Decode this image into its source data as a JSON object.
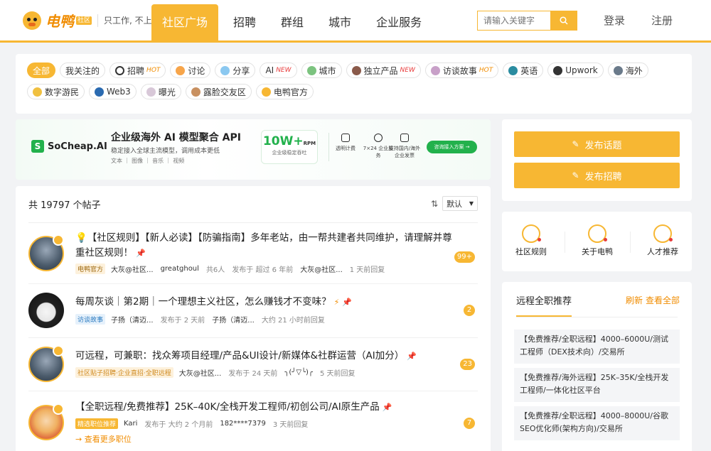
{
  "header": {
    "logo_text": "电鸭",
    "logo_badge": "社区",
    "slogan": "只工作, 不上班",
    "nav": [
      "社区广场",
      "招聘",
      "群组",
      "城市",
      "企业服务"
    ],
    "search_placeholder": "请输入关键字",
    "login": "登录",
    "register": "注册"
  },
  "tags": {
    "row1": [
      {
        "label": "全部",
        "active": true
      },
      {
        "label": "我关注的"
      },
      {
        "label": "招聘",
        "badge": "HOT"
      },
      {
        "label": "讨论"
      },
      {
        "label": "分享"
      },
      {
        "label": "AI",
        "badge": "NEW"
      },
      {
        "label": "城市"
      },
      {
        "label": "独立产品",
        "badge": "NEW"
      },
      {
        "label": "访谈故事",
        "badge": "HOT"
      },
      {
        "label": "英语"
      },
      {
        "label": "Upwork"
      },
      {
        "label": "海外"
      }
    ],
    "row2": [
      {
        "label": "数字游民"
      },
      {
        "label": "Web3"
      },
      {
        "label": "曝光"
      },
      {
        "label": "露脸交友区"
      },
      {
        "label": "电鸭官方"
      }
    ]
  },
  "banner": {
    "brand": "SoCheap.AI",
    "title": "企业级海外 AI 模型聚合 API",
    "subtitle": "稳定接入全球主流模型，调用成本更低",
    "categories": "文本 ｜ 图像 ｜ 音乐 ｜ 视频",
    "stat_value": "10W+",
    "stat_unit": "RPM",
    "stat_label": "企业级稳定吞吐",
    "features": [
      "透明计费",
      "7×24 企业服务",
      "支持国内/海外企业发票"
    ],
    "cta": "咨询接入方案 →"
  },
  "posts": {
    "count_text": "共 19797 个帖子",
    "sort_label": "默认",
    "items": [
      {
        "title": "💡【社区规则】【新人必读】【防骗指南】多年老站，由一帮共建者共同维护，请理解并尊重社区规则！",
        "label": "电鸭官方",
        "author": "大灰@社区...",
        "author2": "greatghoul",
        "people": "共6人",
        "published": "发布于 超过 6 年前",
        "replier": "大灰@社区...",
        "replied": "1 天前回复",
        "count": "99+"
      },
      {
        "title": "每周灰谈｜第2期｜一个理想主义社区，怎么赚钱才不变味？",
        "label": "访谈故事",
        "author": "子扬（清迈...",
        "published": "发布于 2 天前",
        "replier": "子扬（清迈...",
        "replied": "大约 21 小时前回复",
        "count": "2"
      },
      {
        "title": "可远程，可兼职：找众筹项目经理/产品&UI设计/新媒体&社群运营（AI加分）",
        "label": "社区贴子招聘·企业直招·全职远程",
        "author": "大灰@社区...",
        "published": "发布于 24 天前",
        "replier": "╮(╯▽╰)╭",
        "replied": "5 天前回复",
        "count": "23"
      },
      {
        "title": "【全职远程/免费推荐】25K–40K/全栈开发工程师/初创公司/AI原生产品",
        "label": "精选职位推荐",
        "author": "Kari",
        "published": "发布于 大约 2 个月前",
        "replier": "182****7379",
        "replied": "3 天前回复",
        "count": "7"
      }
    ],
    "more_jobs": "→ 查看更多职位"
  },
  "sidebar": {
    "publish_topic": "发布话题",
    "publish_job": "发布招聘",
    "links": [
      "社区规则",
      "关于电鸭",
      "人才推荐"
    ],
    "remote_title": "远程全职推荐",
    "refresh": "刷新",
    "view_all": "查看全部",
    "jobs": [
      "【免费推荐/全职远程】4000–6000U/测试工程师（DEX技术向）/交易所",
      "【免费推荐/海外远程】25K–35K/全栈开发工程师/一体化社区平台",
      "【免费推荐/全职远程】4000–8000U/谷歌SEO优化师(架构方向)/交易所"
    ]
  },
  "colors": {
    "accent": "#f7b733",
    "accent_text": "#f08c00",
    "banner_green": "#22b14c"
  }
}
